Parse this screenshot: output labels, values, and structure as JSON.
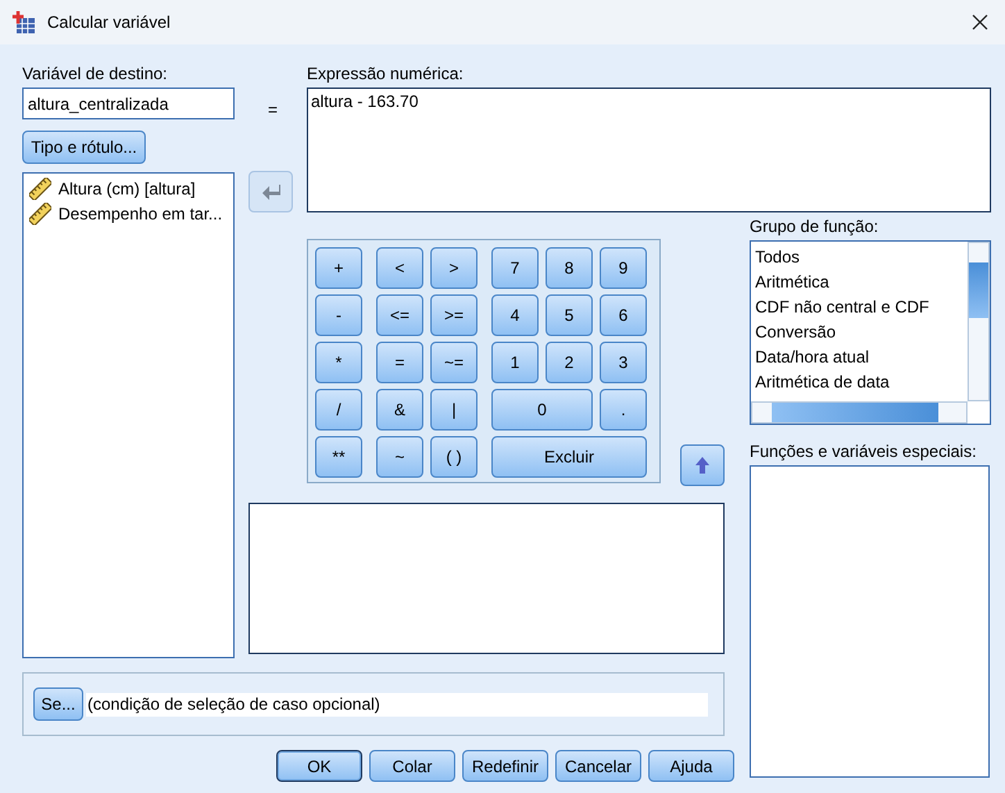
{
  "window": {
    "title": "Calcular variável"
  },
  "target": {
    "label": "Variável de destino:",
    "value": "altura_centralizada",
    "type_button": "Tipo e rótulo..."
  },
  "equals": "=",
  "variables": [
    {
      "label": "Altura (cm) [altura]"
    },
    {
      "label": "Desempenho em tar..."
    }
  ],
  "expression": {
    "label": "Expressão numérica:",
    "value": "altura - 163.70"
  },
  "keypad": [
    {
      "label": "+",
      "kind": "single"
    },
    {
      "label": "<",
      "kind": "single"
    },
    {
      "label": ">",
      "kind": "single"
    },
    {
      "label": "7",
      "kind": "single"
    },
    {
      "label": "8",
      "kind": "single"
    },
    {
      "label": "9",
      "kind": "single"
    },
    {
      "label": "-",
      "kind": "single"
    },
    {
      "label": "<=",
      "kind": "single"
    },
    {
      "label": ">=",
      "kind": "single"
    },
    {
      "label": "4",
      "kind": "single"
    },
    {
      "label": "5",
      "kind": "single"
    },
    {
      "label": "6",
      "kind": "single"
    },
    {
      "label": "*",
      "kind": "single"
    },
    {
      "label": "=",
      "kind": "single"
    },
    {
      "label": "~=",
      "kind": "single"
    },
    {
      "label": "1",
      "kind": "single"
    },
    {
      "label": "2",
      "kind": "single"
    },
    {
      "label": "3",
      "kind": "single"
    },
    {
      "label": "/",
      "kind": "single"
    },
    {
      "label": "&",
      "kind": "single"
    },
    {
      "label": "|",
      "kind": "single"
    },
    {
      "label": "0",
      "kind": "double"
    },
    {
      "label": ".",
      "kind": "single"
    },
    {
      "label": "**",
      "kind": "single"
    },
    {
      "label": "~",
      "kind": "single"
    },
    {
      "label": "( )",
      "kind": "single"
    },
    {
      "label": "Excluir",
      "kind": "triple"
    }
  ],
  "function_group": {
    "label": "Grupo de função:",
    "items": [
      {
        "label": "Todos"
      },
      {
        "label": "Aritmética"
      },
      {
        "label": "CDF não central e CDF"
      },
      {
        "label": "Conversão"
      },
      {
        "label": "Data/hora atual"
      },
      {
        "label": "Aritmética de data"
      }
    ]
  },
  "special": {
    "label": "Funções e variáveis especiais:"
  },
  "condition": {
    "button": "Se...",
    "text": "(condição de seleção de caso opcional)"
  },
  "buttons": [
    {
      "label": "OK",
      "default": true
    },
    {
      "label": "Colar",
      "default": false
    },
    {
      "label": "Redefinir",
      "default": false
    },
    {
      "label": "Cancelar",
      "default": false
    },
    {
      "label": "Ajuda",
      "default": false
    }
  ]
}
